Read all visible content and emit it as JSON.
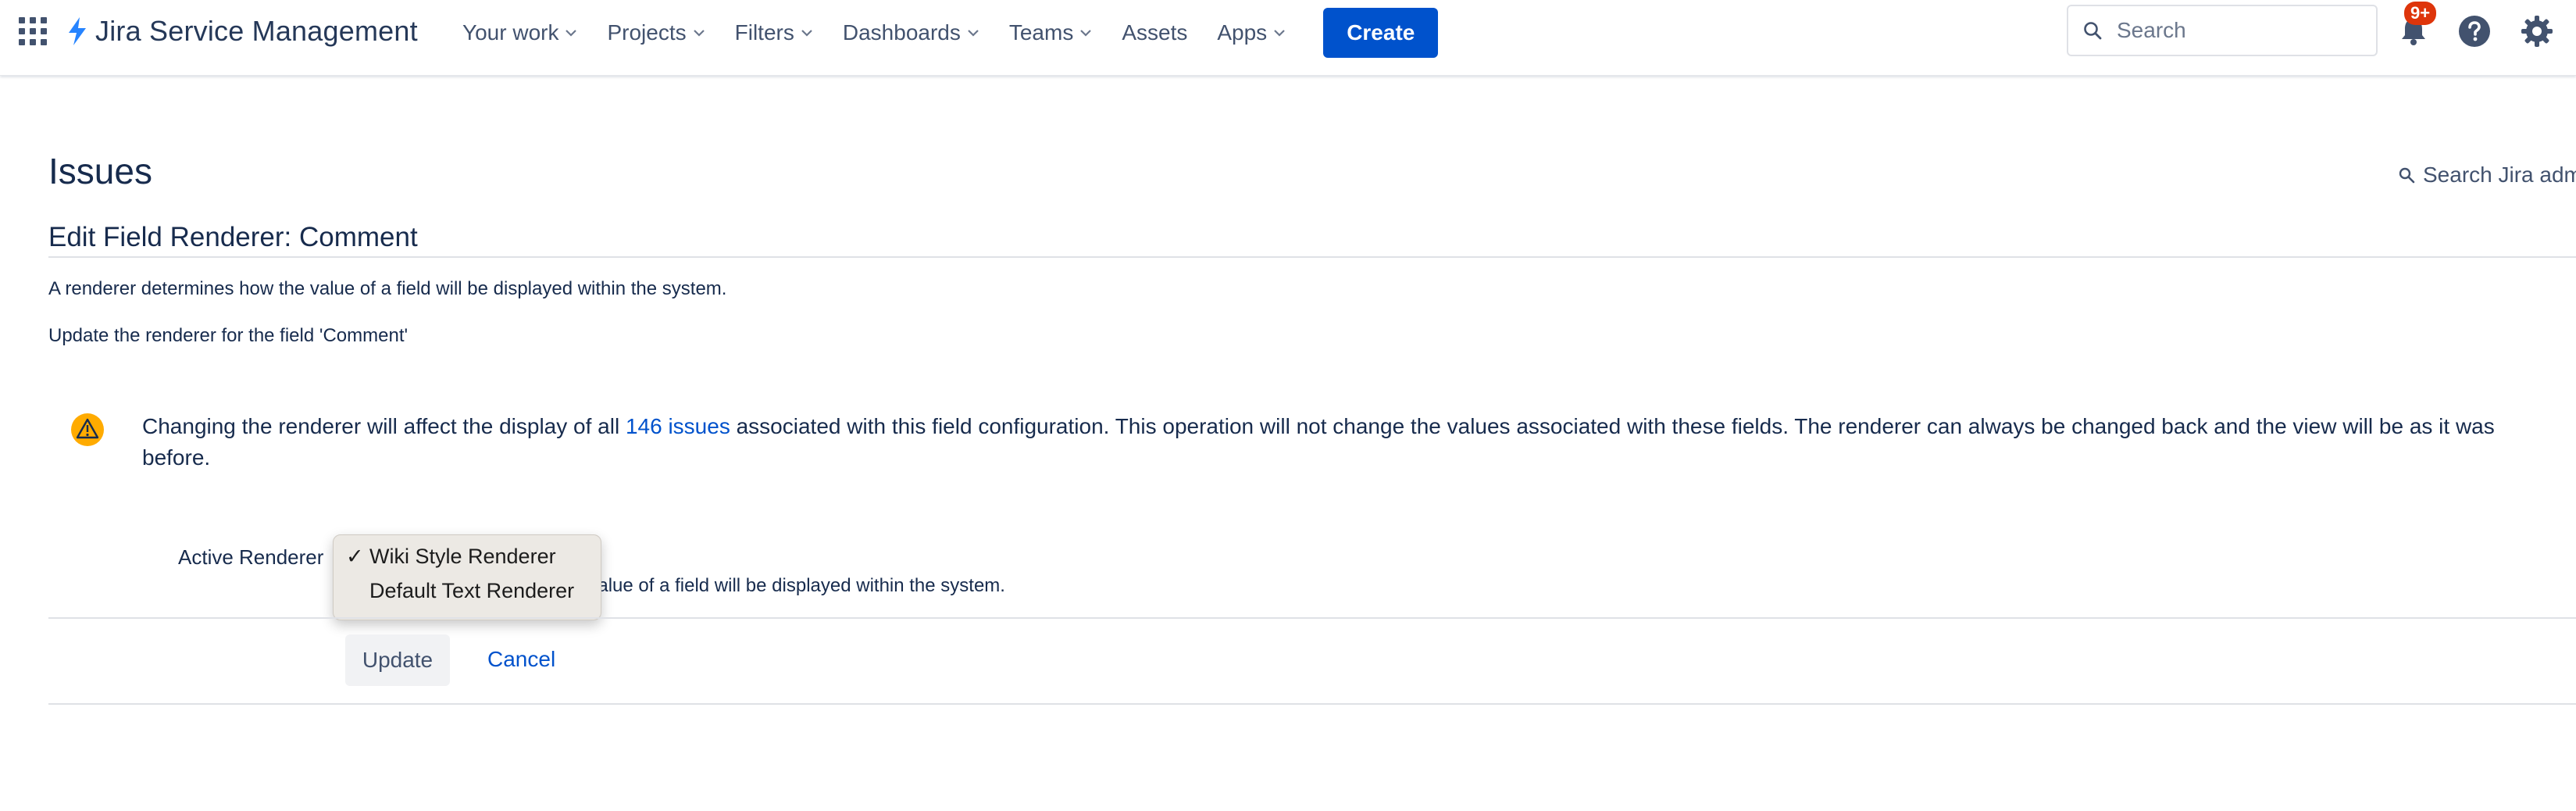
{
  "nav": {
    "app_name": "Jira Service Management",
    "items": [
      {
        "label": "Your work",
        "dropdown": true
      },
      {
        "label": "Projects",
        "dropdown": true
      },
      {
        "label": "Filters",
        "dropdown": true
      },
      {
        "label": "Dashboards",
        "dropdown": true
      },
      {
        "label": "Teams",
        "dropdown": true
      },
      {
        "label": "Assets",
        "dropdown": false
      },
      {
        "label": "Apps",
        "dropdown": true
      }
    ],
    "create_label": "Create",
    "search_placeholder": "Search",
    "notifications_badge": "9+",
    "icons": [
      "app-switcher-icon",
      "jira-logo-icon",
      "search-icon",
      "notifications-icon",
      "help-icon",
      "settings-icon"
    ]
  },
  "page": {
    "title": "Issues",
    "admin_search_label": "Search Jira adm",
    "section_title": "Edit Field Renderer: Comment",
    "description": "A renderer determines how the value of a field will be displayed within the system.",
    "update_prompt": "Update the renderer for the field 'Comment'",
    "warning": {
      "text_before": "Changing the renderer will affect the display of all ",
      "link_text": "146 issues",
      "text_after": " associated with this field configuration. This operation will not change the values associated with these fields. The renderer can always be changed back and the view will be as it was before."
    },
    "form": {
      "label": "Active Renderer",
      "field_description": "he value of a field will be displayed within the system.",
      "dropdown_options": [
        {
          "label": "Wiki Style Renderer",
          "selected": true
        },
        {
          "label": "Default Text Renderer",
          "selected": false
        }
      ],
      "check_mark": "✓",
      "update_label": "Update",
      "cancel_label": "Cancel"
    }
  },
  "colors": {
    "accent": "#0052cc",
    "text": "#172b4d",
    "badge": "#de350b",
    "warning": "#ffab00"
  }
}
